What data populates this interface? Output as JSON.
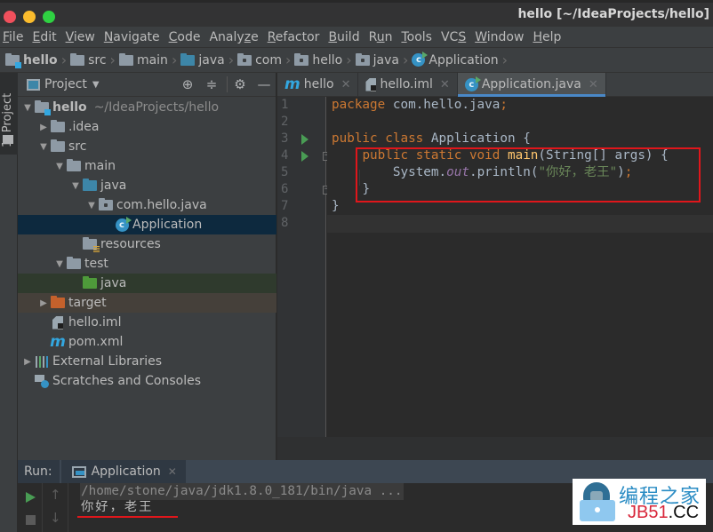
{
  "window": {
    "title": "hello [~/IdeaProjects/hello]",
    "traffic_lights": {
      "close_color": "#f1505c",
      "minimize_color": "#fbbc2d",
      "maximize_color": "#2fd142"
    }
  },
  "menu": [
    {
      "pre": "",
      "mn": "F",
      "post": "ile"
    },
    {
      "pre": "",
      "mn": "E",
      "post": "dit"
    },
    {
      "pre": "",
      "mn": "V",
      "post": "iew"
    },
    {
      "pre": "",
      "mn": "N",
      "post": "avigate"
    },
    {
      "pre": "",
      "mn": "C",
      "post": "ode"
    },
    {
      "pre": "Analy",
      "mn": "z",
      "post": "e"
    },
    {
      "pre": "",
      "mn": "R",
      "post": "efactor"
    },
    {
      "pre": "",
      "mn": "B",
      "post": "uild"
    },
    {
      "pre": "R",
      "mn": "u",
      "post": "n"
    },
    {
      "pre": "",
      "mn": "T",
      "post": "ools"
    },
    {
      "pre": "VC",
      "mn": "S",
      "post": ""
    },
    {
      "pre": "",
      "mn": "W",
      "post": "indow"
    },
    {
      "pre": "",
      "mn": "H",
      "post": "elp"
    }
  ],
  "breadcrumb": [
    {
      "label": "hello",
      "icon": "module-folder-icon"
    },
    {
      "label": "src",
      "icon": "folder-icon"
    },
    {
      "label": "main",
      "icon": "folder-icon"
    },
    {
      "label": "java",
      "icon": "source-folder-icon"
    },
    {
      "label": "com",
      "icon": "package-icon"
    },
    {
      "label": "hello",
      "icon": "package-icon"
    },
    {
      "label": "java",
      "icon": "package-icon"
    },
    {
      "label": "Application",
      "icon": "class-icon"
    }
  ],
  "tool_stripe": {
    "project_label": "1: Project"
  },
  "project_panel": {
    "title": "Project",
    "view_dropdown_icon": "caret-down-icon",
    "header_buttons": [
      "locate-icon",
      "collapse-all-icon",
      "gear-icon",
      "hide-icon"
    ],
    "tree": [
      {
        "label": "hello",
        "sub": "~/IdeaProjects/hello",
        "arrow": "▼",
        "icon": "module"
      },
      {
        "label": ".idea",
        "arrow": "▶",
        "icon": "folder"
      },
      {
        "label": "src",
        "arrow": "▼",
        "icon": "folder"
      },
      {
        "label": "main",
        "arrow": "▼",
        "icon": "folder"
      },
      {
        "label": "java",
        "arrow": "▼",
        "icon": "folder-blue"
      },
      {
        "label": "com.hello.java",
        "arrow": "▼",
        "icon": "package"
      },
      {
        "label": "Application",
        "arrow": "",
        "icon": "class",
        "selected": true
      },
      {
        "label": "resources",
        "arrow": "",
        "icon": "resources"
      },
      {
        "label": "test",
        "arrow": "▼",
        "icon": "folder"
      },
      {
        "label": "java",
        "arrow": "",
        "icon": "folder-green"
      },
      {
        "label": "target",
        "arrow": "▶",
        "icon": "folder-orange"
      },
      {
        "label": "hello.iml",
        "arrow": "",
        "icon": "iml"
      },
      {
        "label": "pom.xml",
        "arrow": "",
        "icon": "maven"
      },
      {
        "label": "External Libraries",
        "arrow": "▶",
        "icon": "libraries"
      },
      {
        "label": "Scratches and Consoles",
        "arrow": "",
        "icon": "scratches"
      }
    ]
  },
  "editor": {
    "tabs": [
      {
        "label": "hello",
        "icon": "maven",
        "active": false
      },
      {
        "label": "hello.iml",
        "icon": "iml",
        "active": false
      },
      {
        "label": "Application.java",
        "icon": "class",
        "active": true
      }
    ],
    "line_numbers": [
      "1",
      "2",
      "3",
      "4",
      "5",
      "6",
      "7",
      "8"
    ],
    "code": {
      "line1": {
        "kw": "package",
        "rest": " com.hello.java",
        "semi": ";"
      },
      "line3": {
        "kw": "public class",
        "rest": " Application {"
      },
      "line4": {
        "indent": "    ",
        "kw": "public static void",
        "sp": " ",
        "fn": "main",
        "rest": "(String[] args) {"
      },
      "line5": {
        "indent": "        ",
        "a": "System.",
        "it": "out",
        "b": ".println(",
        "st": "\"你好，老王\"",
        "c": ")",
        "semi": ";"
      },
      "line6": {
        "indent": "    ",
        "rest": "}"
      },
      "line7": {
        "rest": "}"
      }
    },
    "run_markers_lines": [
      3,
      4
    ],
    "fold_markers_lines": [
      4,
      6
    ],
    "current_line": 8,
    "highlight_annotation_color": "#e0161b"
  },
  "run_panel": {
    "label": "Run:",
    "tab_label": "Application",
    "command": "/home/stone/java/jdk1.8.0_181/bin/java ...",
    "output": "你好，老王",
    "buttons": [
      "rerun-icon",
      "stop-icon",
      "scroll-up-icon",
      "scroll-down-icon"
    ]
  },
  "watermark": {
    "title": "编程之家",
    "domain_red": "JB51",
    "domain_dark": ".CC"
  },
  "colors": {
    "accent": "#4a88c7",
    "keyword": "#cc7832",
    "function": "#ffc66d",
    "string": "#6a8759",
    "static_field": "#9876aa",
    "annotation_red": "#e0161b"
  }
}
